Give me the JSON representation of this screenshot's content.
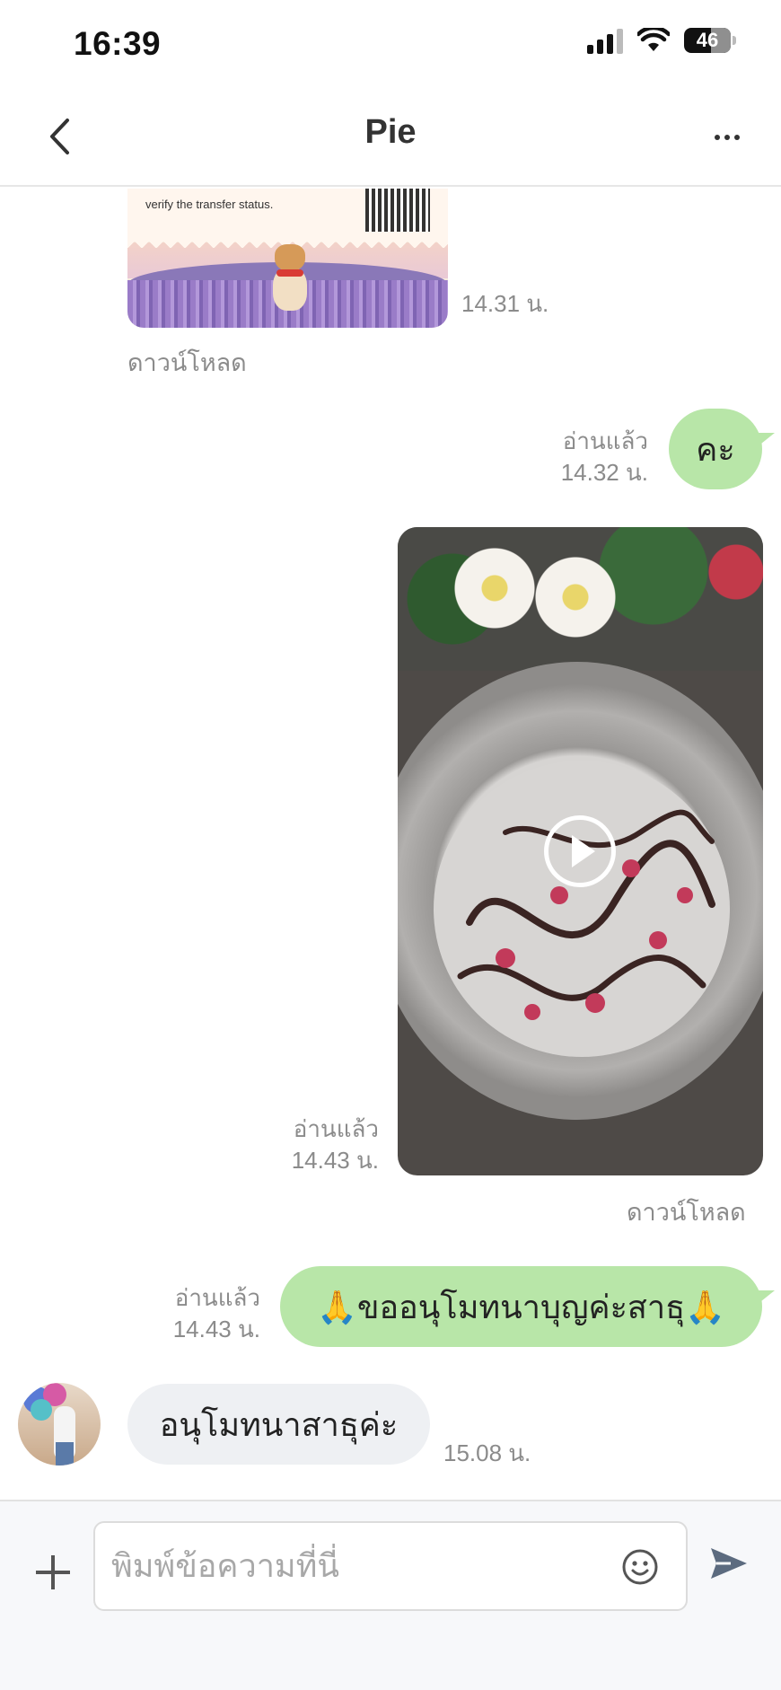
{
  "status_bar": {
    "time": "16:39",
    "battery": "46"
  },
  "header": {
    "title": "Pie"
  },
  "messages": {
    "image": {
      "receipt_text": "verify the transfer status.",
      "time": "14.31 น.",
      "download": "ดาวน์โหลด"
    },
    "sent_1": {
      "text": "คะ",
      "read": "อ่านแล้ว",
      "time": "14.32 น."
    },
    "video": {
      "read": "อ่านแล้ว",
      "time": "14.43 น.",
      "download": "ดาวน์โหลด"
    },
    "sent_2": {
      "text": "🙏ขออนุโมทนาบุญค่ะสาธุ🙏",
      "read": "อ่านแล้ว",
      "time": "14.43 น."
    },
    "received_1": {
      "text": "อนุโมทนาสาธุค่ะ",
      "time": "15.08 น."
    }
  },
  "input": {
    "placeholder": "พิมพ์ข้อความที่นี่"
  },
  "colors": {
    "sent_bubble": "#b8e6a8",
    "received_bubble": "#eef0f3",
    "meta_text": "#8b8b8b"
  },
  "icons": {
    "back": "chevron-left-icon",
    "more": "more-horizontal-icon",
    "plus": "plus-icon",
    "emoji": "smiley-icon",
    "send": "send-arrow-icon",
    "play": "play-icon"
  }
}
